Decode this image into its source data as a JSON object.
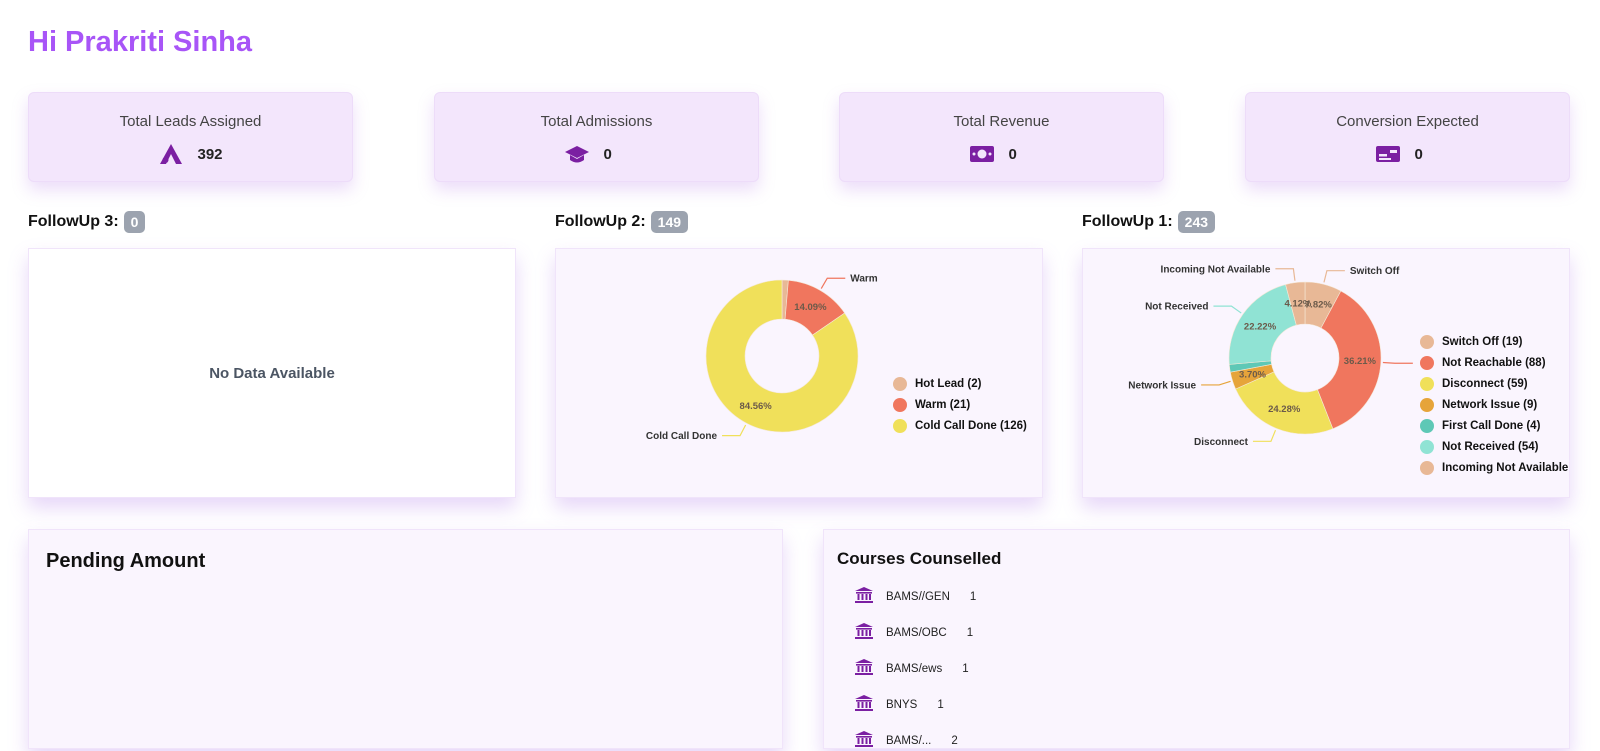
{
  "greeting": "Hi Prakriti Sinha",
  "stats": [
    {
      "title": "Total Leads Assigned",
      "value": "392",
      "icon": "a-logo-icon"
    },
    {
      "title": "Total Admissions",
      "value": "0",
      "icon": "graduation-cap-icon"
    },
    {
      "title": "Total Revenue",
      "value": "0",
      "icon": "money-bill-icon"
    },
    {
      "title": "Conversion Expected",
      "value": "0",
      "icon": "id-card-icon"
    }
  ],
  "followups": [
    {
      "label": "FollowUp 3:",
      "count": "0",
      "empty_text": "No Data Available"
    },
    {
      "label": "FollowUp 2:",
      "count": "149"
    },
    {
      "label": "FollowUp 1:",
      "count": "243"
    }
  ],
  "colors": {
    "accent": "#a855f7",
    "hot_lead": "#e8b896",
    "warm": "#f0765e",
    "cold_call": "#f0e05a",
    "switch_off": "#e8b896",
    "not_reachable": "#f0765e",
    "disconnect": "#f0e05a",
    "network_issue": "#e6a43a",
    "first_call_done": "#5ec8b6",
    "not_received": "#90e3d4",
    "incoming_na": "#e8b896"
  },
  "chart_data": [
    {
      "type": "pie",
      "title": "FollowUp 2",
      "labels": [
        "Hot Lead",
        "Warm",
        "Cold Call Done"
      ],
      "values": [
        2,
        21,
        126
      ],
      "percent_labels": [
        "",
        "14.09%",
        "84.56%"
      ],
      "callouts": [
        "",
        "Warm",
        "Cold Call Done"
      ],
      "legend": [
        "Hot Lead (2)",
        "Warm (21)",
        "Cold Call Done (126)"
      ],
      "legend_position": "right"
    },
    {
      "type": "pie",
      "title": "FollowUp 1",
      "labels": [
        "Switch Off",
        "Not Reachable",
        "Disconnect",
        "Network Issue",
        "First Call Done",
        "Not Received",
        "Incoming Not Available"
      ],
      "values": [
        19,
        88,
        59,
        9,
        4,
        54,
        10
      ],
      "percent_labels": [
        "7.82%",
        "36.21%",
        "24.28%",
        "3.70%",
        "",
        "22.22%",
        "4.12%"
      ],
      "callouts": [
        "Switch Off",
        "Not Reachable",
        "Disconnect",
        "Network Issue",
        "",
        "Not Received",
        "Incoming Not Available"
      ],
      "legend": [
        "Switch Off (19)",
        "Not Reachable (88)",
        "Disconnect (59)",
        "Network Issue (9)",
        "First Call Done (4)",
        "Not Received (54)",
        "Incoming Not Available"
      ],
      "legend_position": "right"
    }
  ],
  "pending": {
    "title": "Pending Amount"
  },
  "courses": {
    "title": "Courses Counselled",
    "items": [
      {
        "name": "BAMS//GEN",
        "count": "1"
      },
      {
        "name": "BAMS/OBC",
        "count": "1"
      },
      {
        "name": "BAMS/ews",
        "count": "1"
      },
      {
        "name": "BNYS",
        "count": "1"
      },
      {
        "name": "BAMS/...",
        "count": "2"
      }
    ]
  }
}
